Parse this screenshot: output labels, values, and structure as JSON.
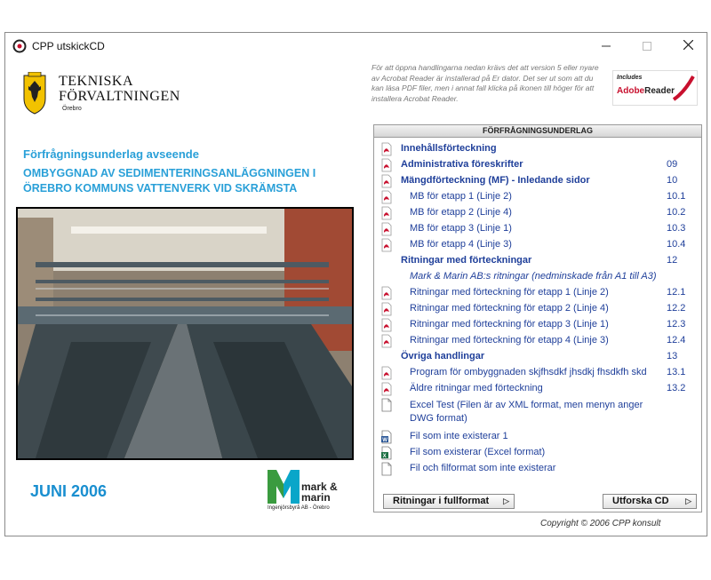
{
  "window": {
    "title": "CPP utskickCD",
    "min_icon": "minimize-icon",
    "max_icon": "maximize-icon",
    "close_icon": "close-icon"
  },
  "logo": {
    "line1": "TEKNISKA",
    "line2": "FÖRVALTNINGEN",
    "line3": "Örebro"
  },
  "subtitle": "Förfrågningsunderlag avseende",
  "project": "OMBYGGNAD AV SEDIMENTERINGSANLÄGGNINGEN I ÖREBRO KOMMUNS VATTENVERK VID SKRÄMSTA",
  "date": "JUNI 2006",
  "partner_logo": {
    "name1": "mark &",
    "name2": "marin",
    "sub": "Ingenjörsbyrå AB - Örebro"
  },
  "info_text": "För att öppna handlingarna nedan krävs det att version 5 eller nyare av Acrobat Reader är installerad på Er dator. Det ser ut som att du kan läsa PDF filer, men i annat fall klicka på ikonen till höger för att installera Acrobat Reader.",
  "adobe_badge": {
    "includes": "Includes",
    "brand": "Adobe",
    "product": "Reader"
  },
  "panel": {
    "header": "FÖRFRÅGNINGSUNDERLAG",
    "items": [
      {
        "label": "Innehållsförteckning",
        "num": "",
        "icon": "pdf-icon"
      },
      {
        "label": "Administrativa föreskrifter",
        "num": "09",
        "icon": "pdf-icon"
      },
      {
        "label": "Mängdförteckning (MF) - Inledande sidor",
        "num": "10",
        "icon": "pdf-icon"
      },
      {
        "label": "MB för etapp 1 (Linje 2)",
        "num": "10.1",
        "icon": "pdf-icon"
      },
      {
        "label": "MB för etapp 2 (Linje 4)",
        "num": "10.2",
        "icon": "pdf-icon"
      },
      {
        "label": "MB för etapp 3 (Linje 1)",
        "num": "10.3",
        "icon": "pdf-icon"
      },
      {
        "label": "MB för etapp 4 (Linje 3)",
        "num": "10.4",
        "icon": "pdf-icon"
      },
      {
        "label": "Ritningar med förteckningar",
        "num": "12",
        "icon": ""
      },
      {
        "label": "Mark & Marin AB:s ritningar (nedminskade från A1 till A3)",
        "num": "",
        "icon": ""
      },
      {
        "label": "Ritningar med förteckning för etapp 1 (Linje 2)",
        "num": "12.1",
        "icon": "pdf-icon"
      },
      {
        "label": "Ritningar med förteckning för etapp 2 (Linje 4)",
        "num": "12.2",
        "icon": "pdf-icon"
      },
      {
        "label": "Ritningar med förteckning för etapp 3 (Linje 1)",
        "num": "12.3",
        "icon": "pdf-icon"
      },
      {
        "label": "Ritningar med förteckning för etapp 4 (Linje 3)",
        "num": "12.4",
        "icon": "pdf-icon"
      },
      {
        "label": "Övriga handlingar",
        "num": "13",
        "icon": ""
      },
      {
        "label": "Program för ombyggnaden skjfhsdkf jhsdkj fhsdkfh skd",
        "num": "13.1",
        "icon": "pdf-icon"
      },
      {
        "label": "Äldre ritningar med förteckning",
        "num": "13.2",
        "icon": "pdf-icon"
      },
      {
        "label": "Excel Test (Filen är av XML format, men menyn anger DWG format)",
        "num": "",
        "icon": "blank-file-icon"
      },
      {
        "label": "Fil som inte existerar 1",
        "num": "",
        "icon": "word-file-icon"
      },
      {
        "label": "Fil som existerar (Excel format)",
        "num": "",
        "icon": "excel-file-icon"
      },
      {
        "label": "Fil och filformat som inte existerar",
        "num": "",
        "icon": "blank-file-icon"
      }
    ],
    "button_full": "Ritningar i fullformat",
    "button_explore": "Utforska CD"
  },
  "copyright": "Copyright © 2006 CPP konsult",
  "colors": {
    "accent": "#2aa0d8",
    "link": "#1f3f9a",
    "pdf": "#c8102e"
  }
}
